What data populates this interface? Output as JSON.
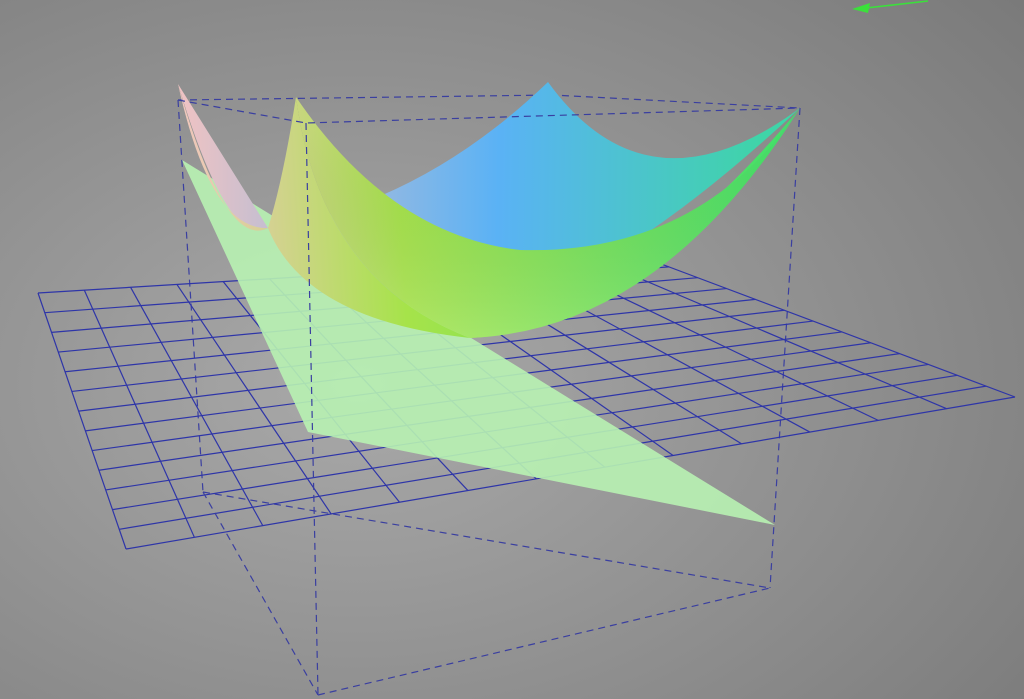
{
  "scene": {
    "background": {
      "center_color": "#a9a9a9",
      "edge_color": "#7a7a7a"
    },
    "grid_plane": {
      "stroke_color": "#2e35a8",
      "divisions": 13
    },
    "bounding_box": {
      "stroke_color": "#3a3fa0",
      "style": "dashed"
    },
    "flat_plane": {
      "fill_color": "#b8f2b2",
      "opacity": 0.9
    },
    "curved_surface": {
      "shape": "saddle / paraboloid",
      "colors": [
        "#f3c6c1",
        "#a6e34a",
        "#5ab2f5",
        "#3fe06b"
      ]
    },
    "axis_indicator": {
      "icon": "arrow-left-icon",
      "color": "#3be03b"
    }
  }
}
